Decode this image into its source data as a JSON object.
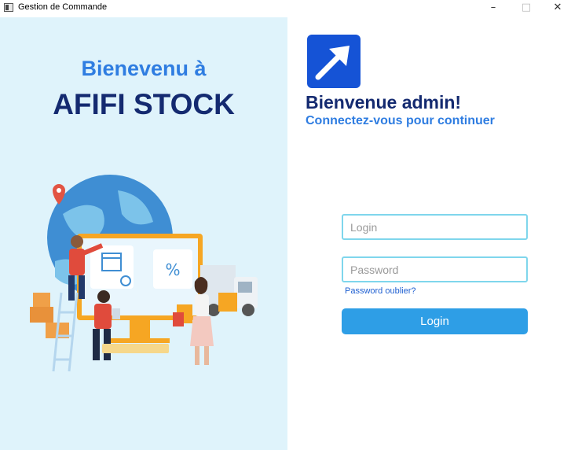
{
  "window": {
    "title": "Gestion de Commande",
    "minimize_glyph": "–",
    "maximize_glyph": "□",
    "close_glyph": "✕"
  },
  "left_panel": {
    "welcome": "Bienevenu à",
    "brand": "AFIFI STOCK"
  },
  "right_panel": {
    "heading": "Bienvenue admin!",
    "subheading": "Connectez-vous pour continuer"
  },
  "form": {
    "login_placeholder": "Login",
    "login_value": "",
    "password_placeholder": "Password",
    "password_value": "",
    "forgot_label": "Password oublier?",
    "submit_label": "Login"
  },
  "colors": {
    "accent": "#2e9ee6",
    "brand_dark": "#142a70",
    "brand_blue": "#2f7de1",
    "panel_bg": "#dff3fb",
    "input_border": "#7fd6ec"
  }
}
